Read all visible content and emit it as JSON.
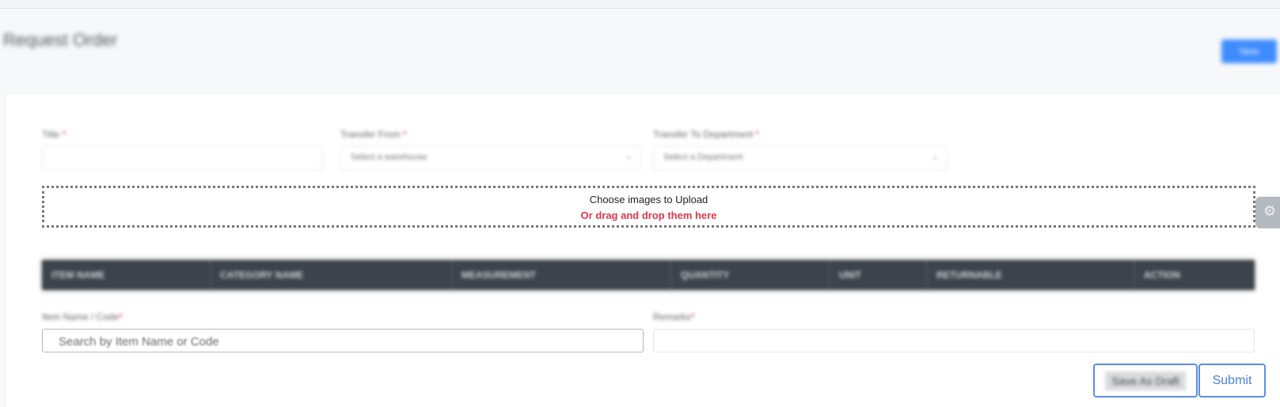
{
  "header": {
    "title": "Request Order",
    "action_button": "New"
  },
  "form": {
    "title_label": "Title",
    "transfer_from_label": "Transfer From",
    "transfer_from_placeholder": "Select a warehouse",
    "transfer_to_label": "Transfer To Department",
    "transfer_to_placeholder": "Select a Department",
    "required_mark": "*"
  },
  "upload": {
    "title": "Choose images to Upload",
    "subtitle": "Or drag and drop them here"
  },
  "table": {
    "columns": [
      "ITEM NAME",
      "CATEGORY NAME",
      "MEASUREMENT",
      "QUANTITY",
      "UNIT",
      "RETURNABLE",
      "ACTION"
    ]
  },
  "item_search": {
    "label": "Item Name / Code",
    "placeholder": "Search by Item Name or Code"
  },
  "remarks": {
    "label": "Remarks"
  },
  "actions": {
    "save_draft": "Save As Draft",
    "submit": "Submit"
  },
  "icons": {
    "settings": "gear-icon",
    "dropdown": "chevron-down-icon"
  },
  "colors": {
    "primary": "#3d8bfd",
    "danger": "#e0364b",
    "table_header": "#3d434b",
    "outline_button": "#5b8de6"
  }
}
